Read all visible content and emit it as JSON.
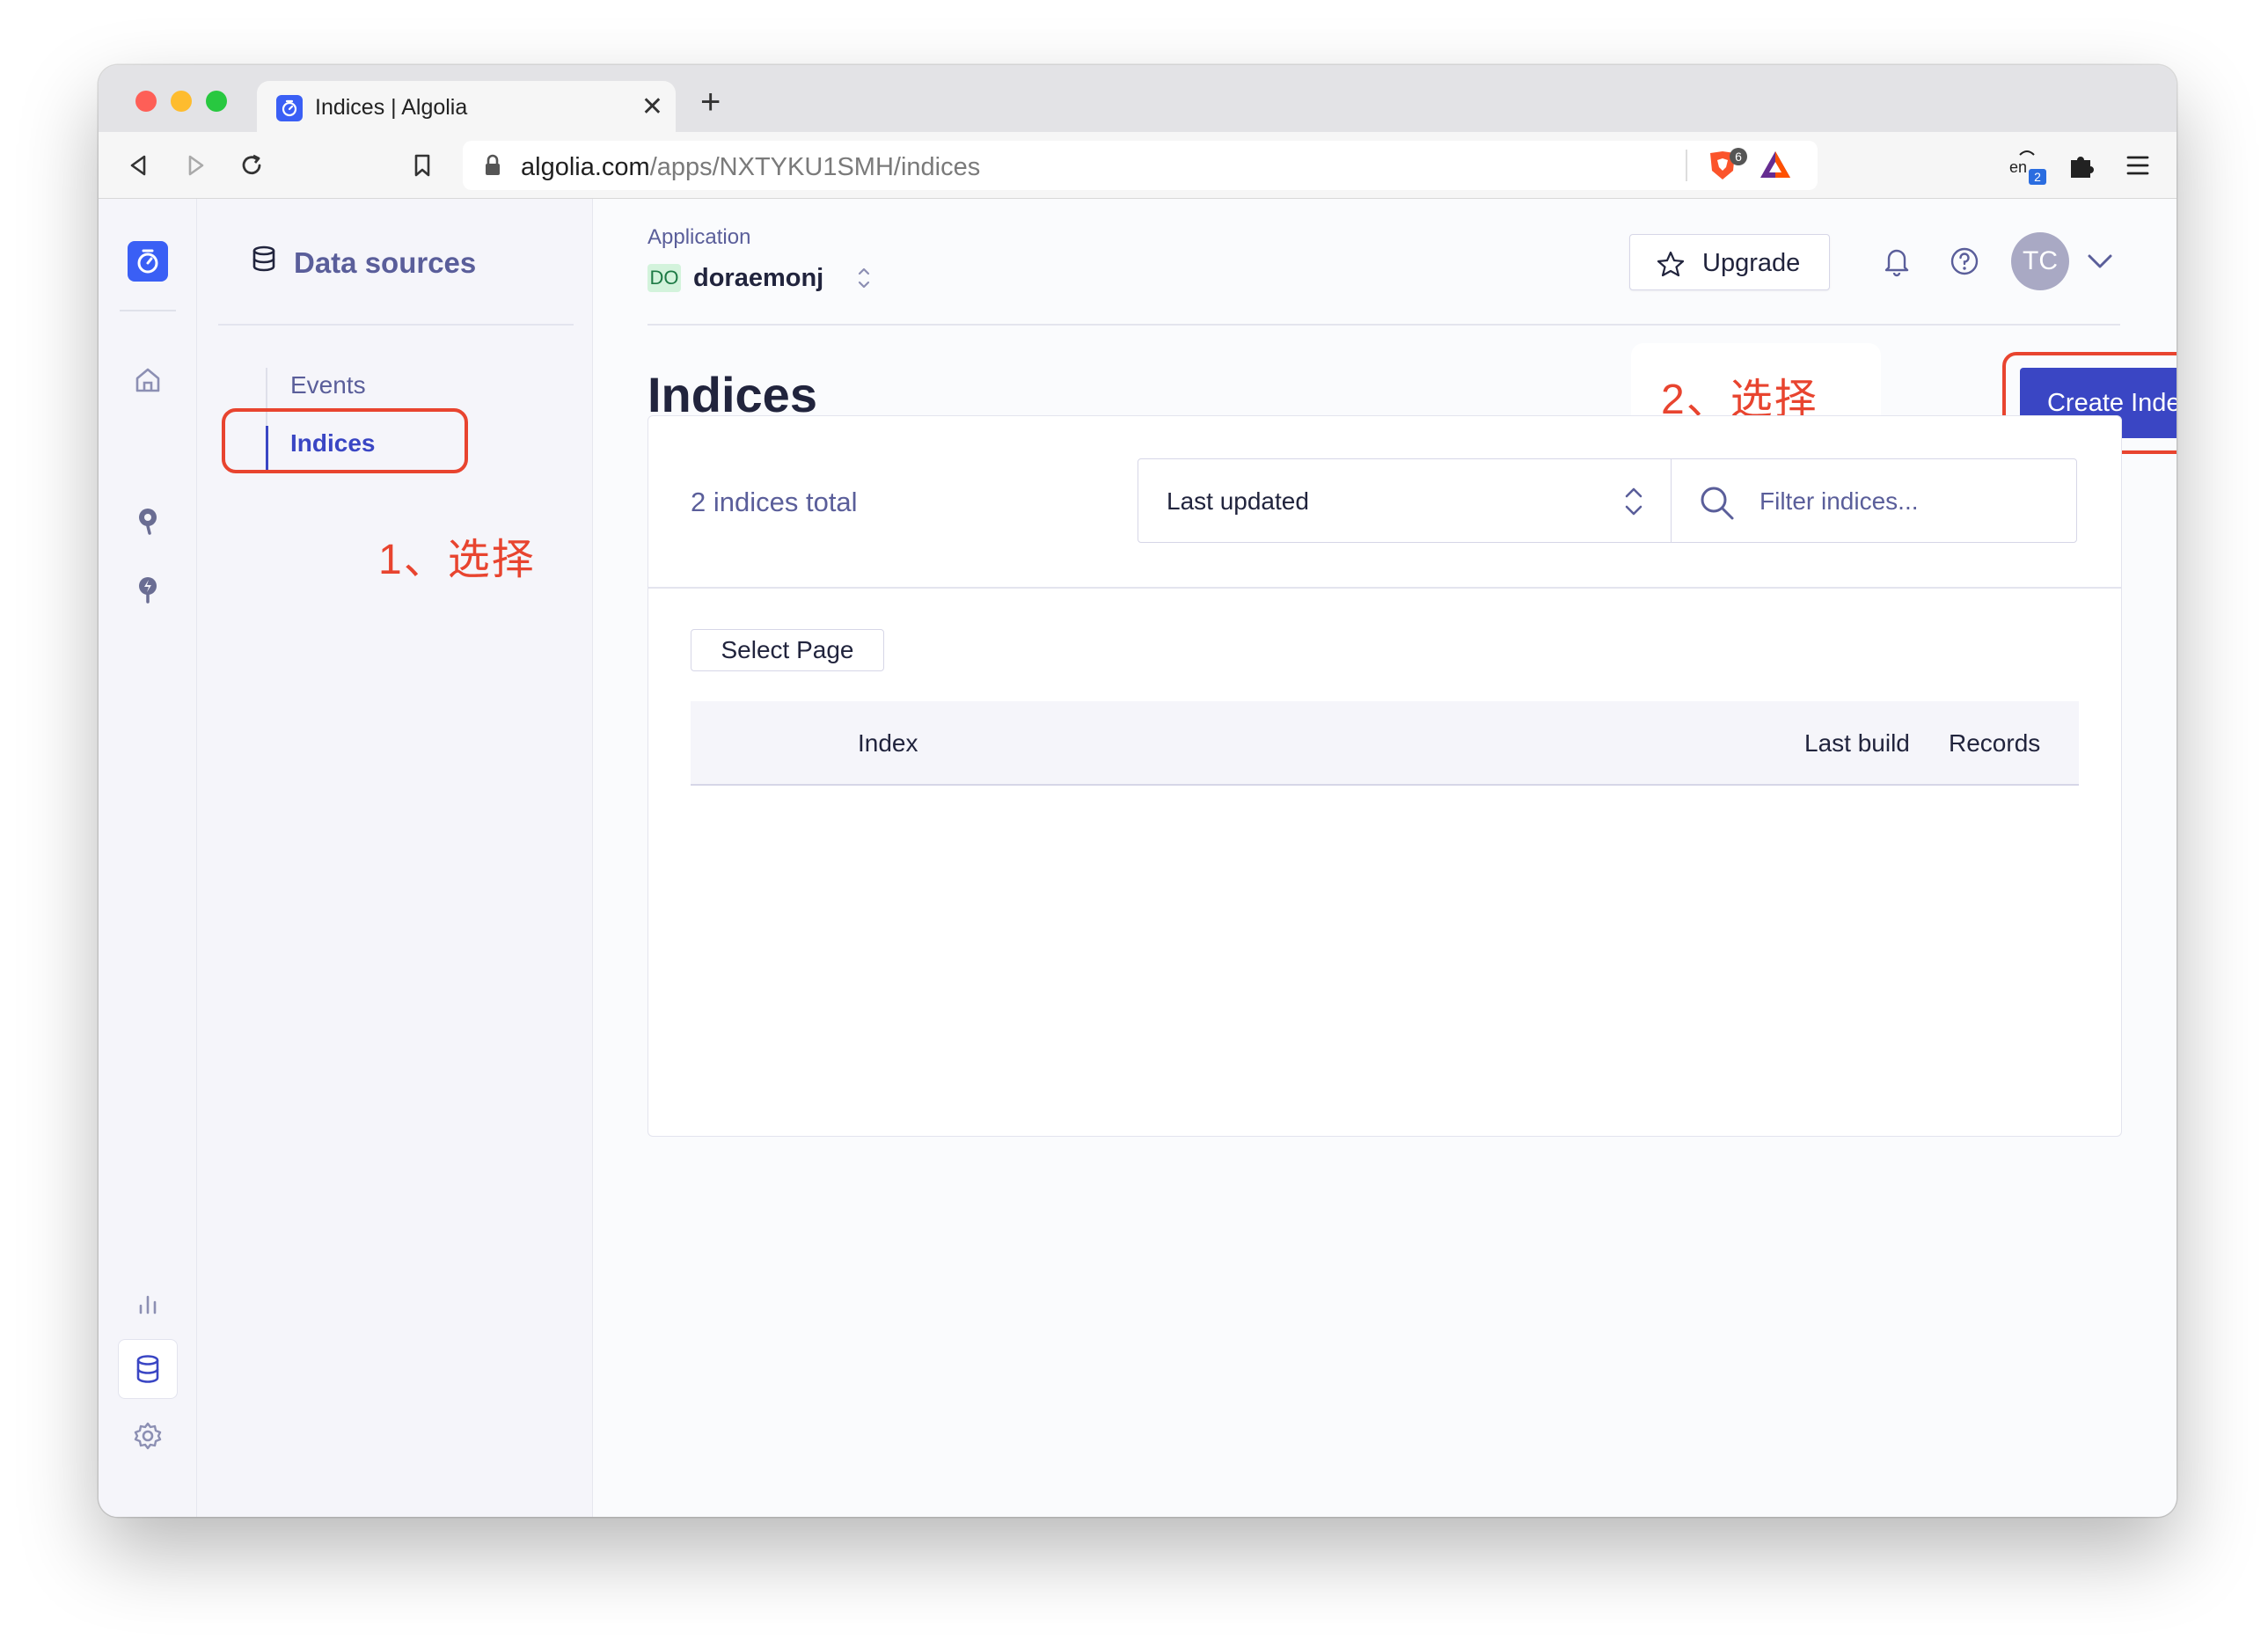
{
  "browser": {
    "tab_title": "Indices | Algolia",
    "url_host": "algolia.com",
    "url_path": "/apps/NXTYKU1SMH/indices",
    "brave_badge": "6",
    "translate_badge": "2"
  },
  "subnav": {
    "title": "Data sources",
    "items": [
      {
        "label": "Events"
      },
      {
        "label": "Indices"
      }
    ]
  },
  "header": {
    "app_label": "Application",
    "app_badge": "DO",
    "app_name": "doraemonj",
    "upgrade_label": "Upgrade",
    "avatar_initials": "TC"
  },
  "main": {
    "page_title": "Indices",
    "create_label": "Create Index",
    "count_text": "2 indices total",
    "sort_value": "Last updated",
    "filter_placeholder": "Filter indices...",
    "select_page_label": "Select Page",
    "columns": [
      "Index",
      "Last build",
      "Records"
    ]
  },
  "annotations": {
    "step1": "1、选择",
    "step2": "2、选择",
    "color": "#e8442f"
  },
  "colors": {
    "accent": "#3a46c4",
    "logo": "#3a5ff5",
    "muted_text": "#5a5e9a"
  },
  "icons": {
    "rail": [
      "home-icon",
      "search-bulb-icon",
      "lightning-bulb-icon",
      "analytics-icon",
      "database-icon",
      "gear-icon"
    ],
    "header": [
      "star-icon",
      "bell-icon",
      "help-icon",
      "chevron-down-icon"
    ]
  }
}
